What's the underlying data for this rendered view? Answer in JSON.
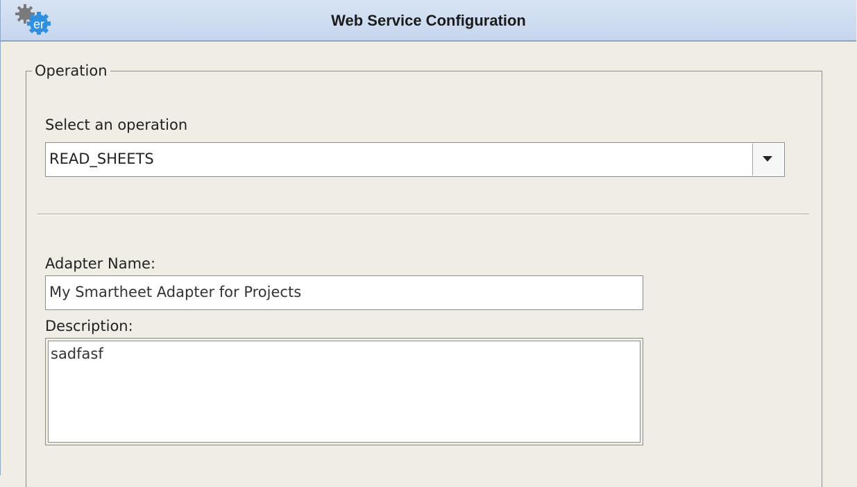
{
  "window": {
    "title": "Web Service Configuration",
    "icon": "gear-er-icon"
  },
  "operation": {
    "group_label": "Operation",
    "select_label": "Select an operation",
    "selected_value": "READ_SHEETS",
    "dropdown_icon": "chevron-down-icon"
  },
  "adapter": {
    "name_label": "Adapter Name:",
    "name_value": "My Smartheet Adapter for Projects",
    "description_label": "Description:",
    "description_value": "sadfasf"
  },
  "colors": {
    "titlebar": "#c6d6ee",
    "background": "#f0ede4",
    "icon_blue": "#2f8fe0"
  }
}
